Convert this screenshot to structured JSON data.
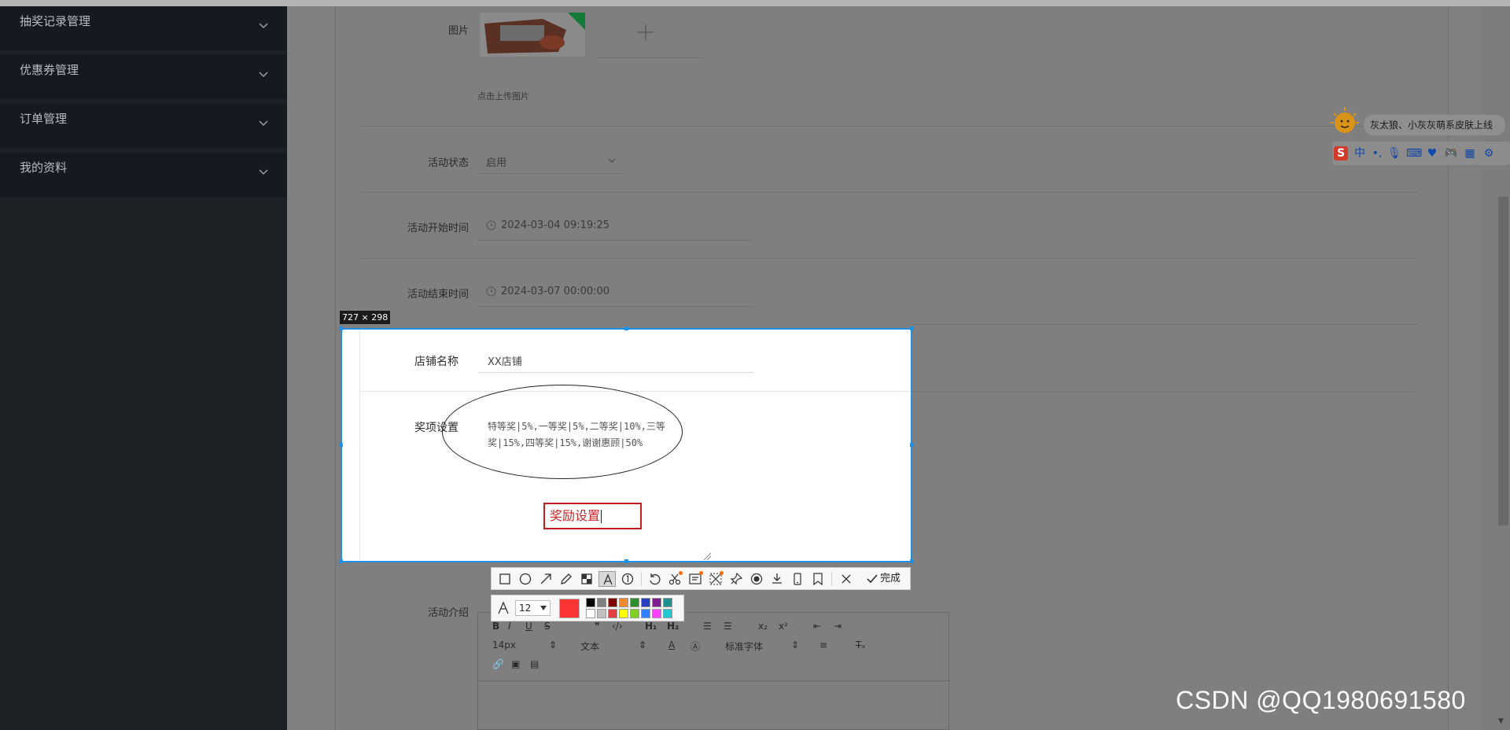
{
  "sidebar": {
    "items": [
      {
        "label": "抽奖记录管理"
      },
      {
        "label": "优惠券管理"
      },
      {
        "label": "订单管理"
      },
      {
        "label": "我的资料"
      }
    ]
  },
  "form": {
    "image_label": "图片",
    "upload_hint": "点击上传图片",
    "status_label": "活动状态",
    "status_value": "启用",
    "start_label": "活动开始时间",
    "start_value": "2024-03-04 09:19:25",
    "end_label": "活动结束时间",
    "end_value": "2024-03-07 00:00:00",
    "intro_label": "活动介绍"
  },
  "selection": {
    "size": "727 × 298",
    "store_label": "店铺名称",
    "store_value": "XX店铺",
    "prize_label": "奖项设置",
    "prize_line1": "特等奖|5%,一等奖|5%,二等奖|10%,三等",
    "prize_line2": "奖|15%,四等奖|15%,谢谢惠顾|50%",
    "annotation_text": "奖励设置"
  },
  "toolbar": {
    "done_label": "完成",
    "font_size": "12",
    "current_color": "#fb3434",
    "palette": [
      "#000000",
      "#808080",
      "#800000",
      "#f08a30",
      "#2f8f2f",
      "#2c3fbf",
      "#7f1f8f",
      "#1f8f8f",
      "#ffffff",
      "#c0c0c0",
      "#e04040",
      "#ffff00",
      "#80d020",
      "#3080ff",
      "#ff40ff",
      "#20c8d0"
    ]
  },
  "editor": {
    "font_size": "14px",
    "para": "文本",
    "font": "标准字体"
  },
  "ime": {
    "notice": "灰太狼、小灰灰萌系皮肤上线"
  },
  "watermark": "CSDN @QQ1980691580"
}
